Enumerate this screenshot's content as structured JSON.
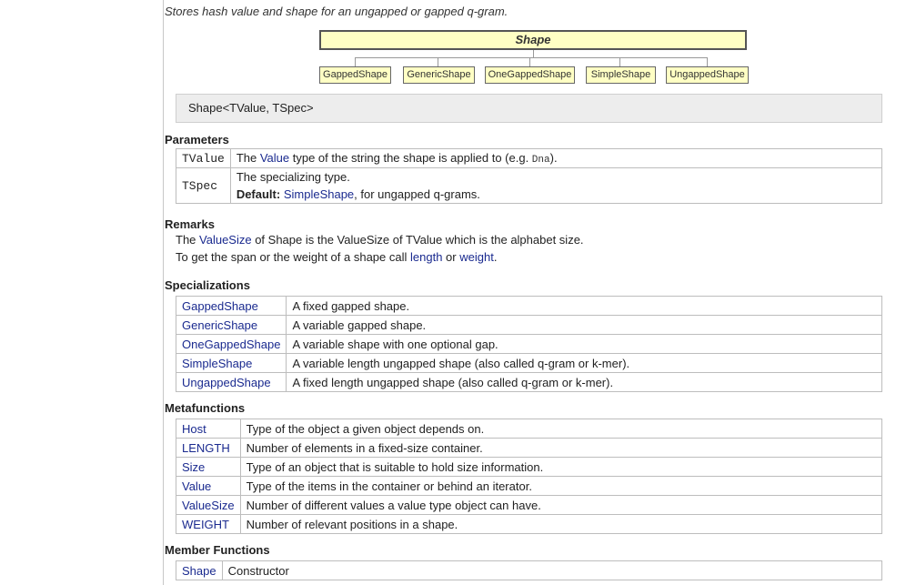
{
  "intro": "Stores hash value and shape for an ungapped or gapped q-gram.",
  "diagram": {
    "root": "Shape",
    "children": [
      "GappedShape",
      "GenericShape",
      "OneGappedShape",
      "SimpleShape",
      "UngappedShape"
    ]
  },
  "signature": "Shape<TValue, TSpec>",
  "parameters": {
    "heading": "Parameters",
    "rows": [
      {
        "name": "TValue",
        "pre": "The ",
        "link": "Value",
        "post": " type of the string the shape is applied to (e.g. ",
        "code": "Dna",
        "end": ")."
      },
      {
        "name": "TSpec",
        "line1": "The specializing type.",
        "default_label": "Default:",
        "default_link": "SimpleShape",
        "default_rest": ", for ungapped q-grams."
      }
    ]
  },
  "remarks": {
    "heading": "Remarks",
    "line1": {
      "pre": "The ",
      "link": "ValueSize",
      "post": " of Shape is the ValueSize of TValue which is the alphabet size."
    },
    "line2": {
      "pre": "To get the span or the weight of a shape call ",
      "link1": "length",
      "mid": " or ",
      "link2": "weight",
      "post": "."
    }
  },
  "specializations": {
    "heading": "Specializations",
    "rows": [
      {
        "name": "GappedShape",
        "desc": "A fixed gapped shape."
      },
      {
        "name": "GenericShape",
        "desc": "A variable gapped shape."
      },
      {
        "name": "OneGappedShape",
        "desc": "A variable shape with one optional gap."
      },
      {
        "name": "SimpleShape",
        "desc": "A variable length ungapped shape (also called q-gram or k-mer)."
      },
      {
        "name": "UngappedShape",
        "desc": "A fixed length ungapped shape (also called q-gram or k-mer)."
      }
    ]
  },
  "metafunctions": {
    "heading": "Metafunctions",
    "rows": [
      {
        "name": "Host",
        "desc": "Type of the object a given object depends on."
      },
      {
        "name": "LENGTH",
        "desc": "Number of elements in a fixed-size container."
      },
      {
        "name": "Size",
        "desc": "Type of an object that is suitable to hold size information."
      },
      {
        "name": "Value",
        "desc": "Type of the items in the container or behind an iterator."
      },
      {
        "name": "ValueSize",
        "desc": "Number of different values a value type object can have."
      },
      {
        "name": "WEIGHT",
        "desc": "Number of relevant positions in a shape."
      }
    ]
  },
  "member_functions": {
    "heading": "Member Functions",
    "rows": [
      {
        "name": "Shape",
        "desc": "Constructor"
      }
    ]
  },
  "colors": {
    "link": "#1a2a8f",
    "diagram_fill": "#ffffc4",
    "signature_bg": "#ededed"
  }
}
